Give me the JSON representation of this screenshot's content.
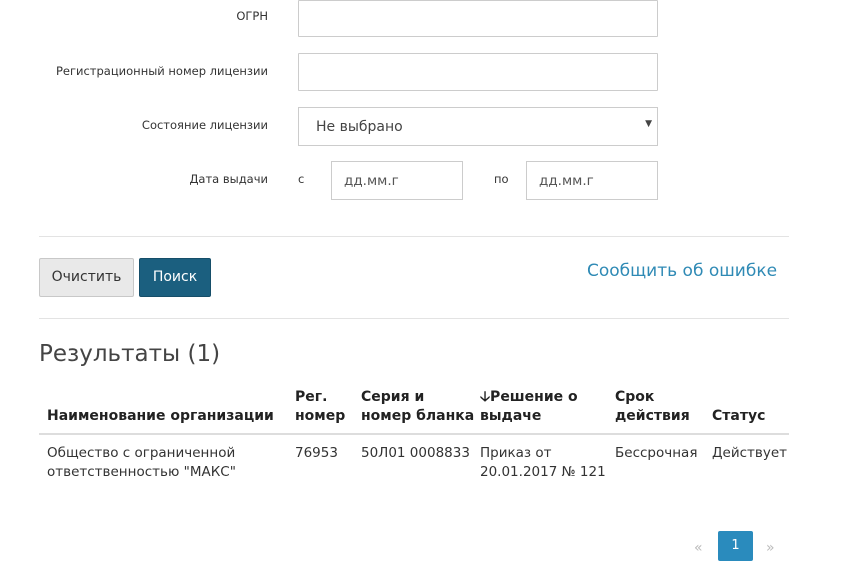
{
  "form": {
    "ogrn_label": "ОГРН",
    "reg_number_label": "Регистрационный номер лицензии",
    "license_state_label": "Состояние лицензии",
    "license_state_value": "Не выбрано",
    "issue_date_label": "Дата выдачи",
    "date_from_label": "с",
    "date_from_placeholder": "дд.мм.г",
    "date_to_label": "по",
    "date_to_placeholder": "дд.мм.г"
  },
  "actions": {
    "clear_label": "Очистить",
    "search_label": "Поиск",
    "report_error_label": "Сообщить об ошибке"
  },
  "results": {
    "title": "Результаты (1)",
    "headers": {
      "org_name": "Наименование организации",
      "reg_num_1": "Рег.",
      "reg_num_2": "номер",
      "series_1": "Серия и",
      "series_2": "номер бланка",
      "decision_1": "🡣Решение о",
      "decision_2": "выдаче",
      "term_1": "Срок",
      "term_2": "действия",
      "status": "Статус"
    },
    "rows": [
      {
        "org_name_1": "Общество с ограниченной",
        "org_name_2": "ответственностью \"МАКС\"",
        "reg_num": "76953",
        "series": "50Л01 0008833",
        "decision_1": "Приказ от",
        "decision_2": "20.01.2017 № 121",
        "term": "Бессрочная",
        "status": "Действует"
      }
    ]
  },
  "pagination": {
    "prev": "«",
    "current": "1",
    "next": "»"
  }
}
